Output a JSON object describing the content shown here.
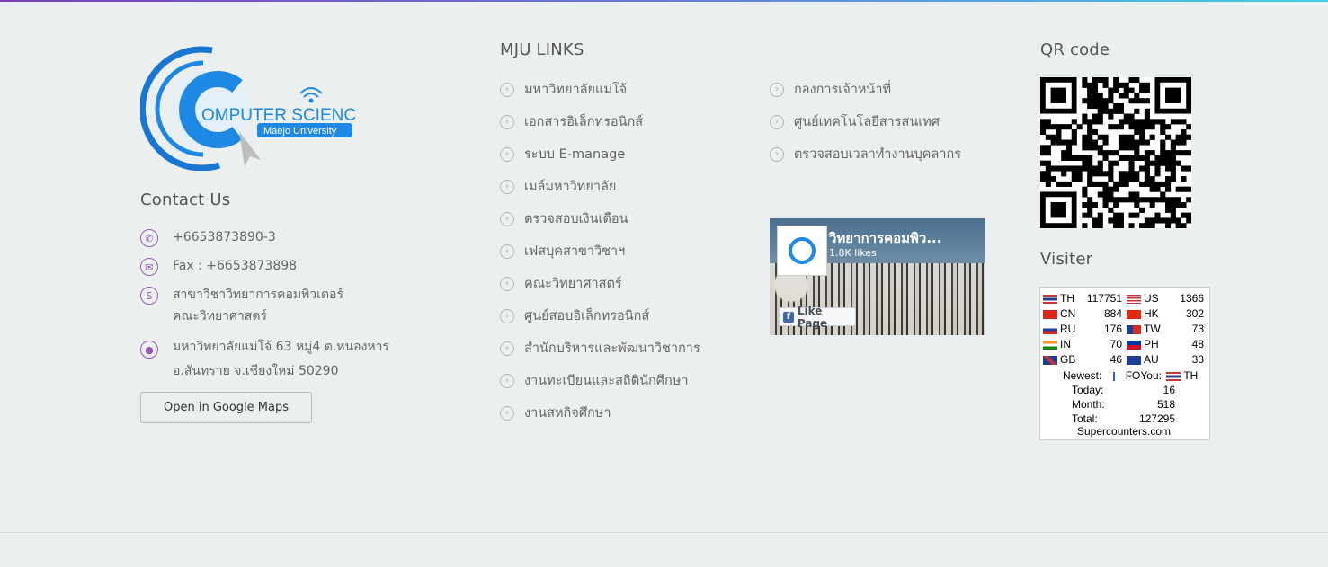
{
  "logo": {
    "text_line1": "OMPUTER SCIENCE",
    "text_line2": "Maejo University"
  },
  "contact": {
    "title": "Contact Us",
    "phone": "+6653873890-3",
    "fax": "Fax : +6653873898",
    "dept_line1": "สาขาวิชาวิทยาการคอมพิวเตอร์",
    "dept_line2": "คณะวิทยาศาสตร์",
    "address_line1": "มหาวิทยาลัยแม่โจ้ 63 หมู่4 ต.หนองหาร",
    "address_line2": "อ.สันทราย จ.เชียงใหม่ 50290",
    "maps_button": "Open in Google Maps"
  },
  "links": {
    "title": "MJU LINKS",
    "col1": [
      "มหาวิทยาลัยแม่โจ้",
      "เอกสารอิเล็กทรอนิกส์",
      "ระบบ E-manage",
      "เมล์มหาวิทยาลัย",
      "ตรวจสอบเงินเดือน",
      "เฟสบุคสาขาวิชาฯ",
      "คณะวิทยาศาสตร์",
      "ศูนย์สอบอิเล็กทรอนิกส์",
      "สำนักบริหารและพัฒนาวิชาการ",
      "งานทะเบียนและสถิตินักศึกษา",
      "งานสหกิจศึกษา"
    ],
    "col2": [
      "กองการเจ้าหน้าที่",
      "ศูนย์เทคโนโลยีสารสนเทศ",
      "ตรวจสอบเวลาทำงานบุคลากร"
    ]
  },
  "facebook": {
    "page_name": "วิทยาการคอมพิว...",
    "likes": "1.8K likes",
    "like_button": "Like Page"
  },
  "qr": {
    "title": "QR code"
  },
  "visitor": {
    "title": "Visiter",
    "rows": [
      {
        "c1": "TH",
        "v1": "117751",
        "c2": "US",
        "v2": "1366"
      },
      {
        "c1": "CN",
        "v1": "884",
        "c2": "HK",
        "v2": "302"
      },
      {
        "c1": "RU",
        "v1": "176",
        "c2": "TW",
        "v2": "73"
      },
      {
        "c1": "IN",
        "v1": "70",
        "c2": "PH",
        "v2": "48"
      },
      {
        "c1": "GB",
        "v1": "46",
        "c2": "AU",
        "v2": "33"
      }
    ],
    "newest_label": "Newest:",
    "newest_code": "FO",
    "you_label": "You:",
    "you_code": "TH",
    "today_label": "Today:",
    "today": "16",
    "month_label": "Month:",
    "month": "518",
    "total_label": "Total:",
    "total": "127295",
    "footer": "Supercounters.com"
  }
}
